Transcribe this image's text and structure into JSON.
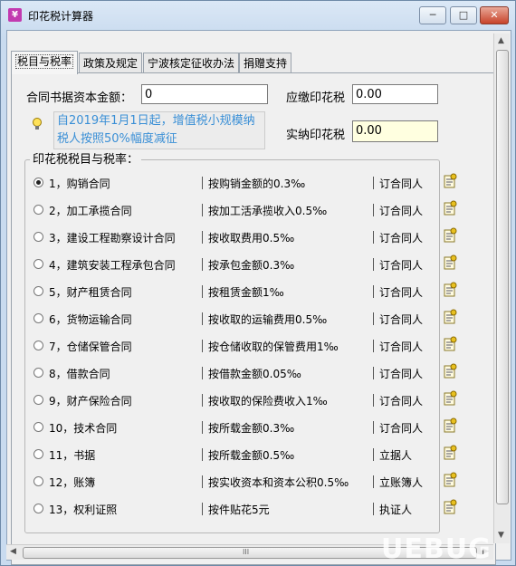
{
  "window": {
    "title": "印花税计算器",
    "controls": {
      "minimize": "─",
      "maximize": "□",
      "close": "✕"
    }
  },
  "tabs": [
    {
      "label": "税目与税率",
      "active": true
    },
    {
      "label": "政策及规定",
      "active": false
    },
    {
      "label": "宁波核定征收办法",
      "active": false
    },
    {
      "label": "捐赠支持",
      "active": false
    }
  ],
  "form": {
    "capital_label": "合同书据资本金额：",
    "capital_value": "0",
    "payable_label": "应缴印花税",
    "payable_value": "0.00",
    "actual_label": "实纳印花税",
    "actual_value": "0.00"
  },
  "notice": "自2019年1月1日起，增值税小规模纳税人按照50%幅度减征",
  "group_title": "印花税税目与税率：",
  "items": [
    {
      "name": "1，购销合同",
      "rate": "按购销金额的0.3‰",
      "payer": "订合同人",
      "selected": true
    },
    {
      "name": "2，加工承揽合同",
      "rate": "按加工活承揽收入0.5‰",
      "payer": "订合同人",
      "selected": false
    },
    {
      "name": "3，建设工程勘察设计合同",
      "rate": "按收取费用0.5‰",
      "payer": "订合同人",
      "selected": false
    },
    {
      "name": "4，建筑安装工程承包合同",
      "rate": "按承包金额0.3‰",
      "payer": "订合同人",
      "selected": false
    },
    {
      "name": "5，财产租赁合同",
      "rate": "按租赁金额1‰",
      "payer": "订合同人",
      "selected": false
    },
    {
      "name": "6，货物运输合同",
      "rate": "按收取的运输费用0.5‰",
      "payer": "订合同人",
      "selected": false
    },
    {
      "name": "7，仓储保管合同",
      "rate": "按仓储收取的保管费用1‰",
      "payer": "订合同人",
      "selected": false
    },
    {
      "name": "8，借款合同",
      "rate": "按借款金额0.05‰",
      "payer": "订合同人",
      "selected": false
    },
    {
      "name": "9，财产保险合同",
      "rate": "按收取的保险费收入1‰",
      "payer": "订合同人",
      "selected": false
    },
    {
      "name": "10，技术合同",
      "rate": "按所载金额0.3‰",
      "payer": "订合同人",
      "selected": false
    },
    {
      "name": "11，书据",
      "rate": "按所载金额0.5‰",
      "payer": "立据人",
      "selected": false
    },
    {
      "name": "12，账簿",
      "rate": "按实收资本和资本公积0.5‰",
      "payer": "立账簿人",
      "selected": false
    },
    {
      "name": "13，权利证照",
      "rate": "按件贴花5元",
      "payer": "执证人",
      "selected": false
    }
  ],
  "scroll": {
    "up": "▲",
    "down": "▼",
    "left": "◀",
    "right": "▶",
    "grip": "III"
  },
  "watermark": "UEBUG"
}
